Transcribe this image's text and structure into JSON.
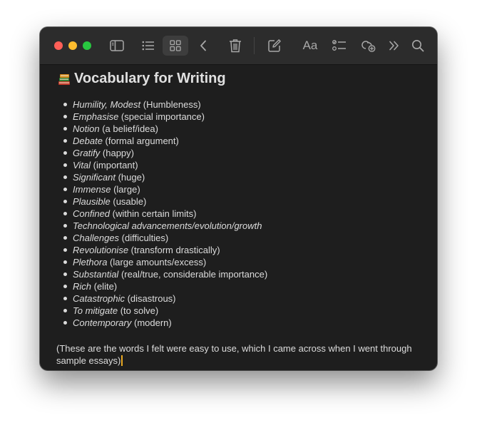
{
  "window": {
    "traffic_lights": {
      "close_color": "#ff5f57",
      "minimize_color": "#febc2e",
      "zoom_color": "#28c840"
    }
  },
  "toolbar": {
    "icons": {
      "sidebar": "sidebar-icon",
      "list_view": "list-view-icon",
      "gallery_view": "gallery-view-icon",
      "back": "chevron-left-icon",
      "delete": "trash-icon",
      "compose": "compose-icon",
      "format": "text-format-icon",
      "checklist": "checklist-icon",
      "share": "collaborate-icon",
      "more": "chevrons-right-icon",
      "search": "search-icon"
    },
    "format_label": "Aa",
    "gallery_active": true
  },
  "note": {
    "title": "Vocabulary for Writing",
    "title_icon": "books-emoji",
    "items": [
      {
        "word": "Humility, Modest",
        "meaning": " (Humbleness)"
      },
      {
        "word": "Emphasise",
        "meaning": " (special importance)"
      },
      {
        "word": "Notion",
        "meaning": " (a belief/idea)"
      },
      {
        "word": "Debate",
        "meaning": " (formal argument)"
      },
      {
        "word": "Gratify",
        "meaning": " (happy)"
      },
      {
        "word": "Vital",
        "meaning": " (important)"
      },
      {
        "word": "Significant",
        "meaning": " (huge)"
      },
      {
        "word": "Immense",
        "meaning": " (large)"
      },
      {
        "word": "Plausible",
        "meaning": " (usable)"
      },
      {
        "word": "Confined",
        "meaning": " (within certain limits)"
      },
      {
        "word": "Technological advancements/evolution/growth",
        "meaning": ""
      },
      {
        "word": "Challenges",
        "meaning": " (difficulties)"
      },
      {
        "word": "Revolutionise",
        "meaning": " (transform drastically)"
      },
      {
        "word": "Plethora",
        "meaning": " (large amounts/excess)"
      },
      {
        "word": "Substantial",
        "meaning": " (real/true, considerable importance)"
      },
      {
        "word": "Rich",
        "meaning": " (elite)"
      },
      {
        "word": "Catastrophic",
        "meaning": " (disastrous)"
      },
      {
        "word": "To mitigate",
        "meaning": " (to solve)"
      },
      {
        "word": "Contemporary",
        "meaning": " (modern)"
      }
    ],
    "footer_text": "(These are the words I felt were easy to use, which I came across when I went through sample essays)",
    "caret_color": "#e8a823"
  }
}
